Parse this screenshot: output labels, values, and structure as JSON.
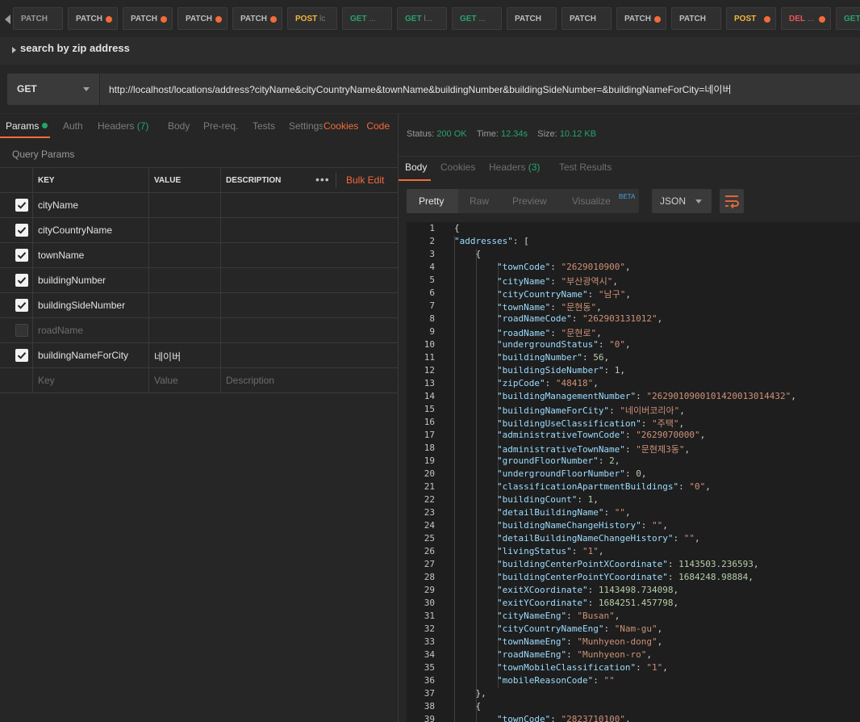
{
  "tabs": [
    {
      "method": "PATCH",
      "color": "#9a9a9a",
      "dirty": false
    },
    {
      "method": "PATCH",
      "color": "#bdbdbd",
      "dirty": true
    },
    {
      "method": "PATCH",
      "color": "#bdbdbd",
      "dirty": true
    },
    {
      "method": "PATCH",
      "color": "#bdbdbd",
      "dirty": true
    },
    {
      "method": "PATCH",
      "color": "#bdbdbd",
      "dirty": true
    },
    {
      "method": "POST",
      "color": "#f5b73b",
      "dirty": false,
      "suffix": " lc"
    },
    {
      "method": "GET",
      "color": "#25a46b",
      "dirty": false,
      "suffix": " ..."
    },
    {
      "method": "GET",
      "color": "#25a46b",
      "dirty": false,
      "suffix": " l..."
    },
    {
      "method": "GET",
      "color": "#25a46b",
      "dirty": false,
      "suffix": " ..."
    },
    {
      "method": "PATCH",
      "color": "#bdbdbd",
      "dirty": false
    },
    {
      "method": "PATCH",
      "color": "#bdbdbd",
      "dirty": false
    },
    {
      "method": "PATCH",
      "color": "#bdbdbd",
      "dirty": true
    },
    {
      "method": "PATCH",
      "color": "#bdbdbd",
      "dirty": false
    },
    {
      "method": "POST",
      "color": "#f5b73b",
      "dirty": true
    },
    {
      "method": "DEL",
      "color": "#e8555a",
      "dirty": true,
      "suffix": " ..."
    },
    {
      "method": "GET",
      "color": "#25a46b",
      "dirty": false
    }
  ],
  "request": {
    "title": "search by zip address",
    "method": "GET",
    "url": "http://localhost/locations/address?cityName&cityCountryName&townName&buildingNumber&buildingSideNumber=&buildingNameForCity=네이버"
  },
  "req_tabs": {
    "params": "Params",
    "auth": "Auth",
    "headers": "Headers",
    "headers_count": "(7)",
    "body": "Body",
    "prereq": "Pre-req.",
    "tests": "Tests",
    "settings": "Settings",
    "cookies": "Cookies",
    "code": "Code"
  },
  "query_params_label": "Query Params",
  "param_headers": {
    "key": "KEY",
    "value": "VALUE",
    "description": "DESCRIPTION",
    "more": "•••",
    "bulk_edit": "Bulk Edit"
  },
  "params": [
    {
      "key": "cityName",
      "value": "",
      "checked": true
    },
    {
      "key": "cityCountryName",
      "value": "",
      "checked": true
    },
    {
      "key": "townName",
      "value": "",
      "checked": true
    },
    {
      "key": "buildingNumber",
      "value": "",
      "checked": true
    },
    {
      "key": "buildingSideNumber",
      "value": "",
      "checked": true
    },
    {
      "key": "roadName",
      "value": "",
      "checked": false
    },
    {
      "key": "buildingNameForCity",
      "value": "네이버",
      "checked": true
    }
  ],
  "param_placeholders": {
    "key": "Key",
    "value": "Value",
    "description": "Description"
  },
  "response": {
    "status_label": "Status:",
    "status": "200 OK",
    "time_label": "Time:",
    "time": "12.34s",
    "size_label": "Size:",
    "size": "10.12 KB",
    "tabs": {
      "body": "Body",
      "cookies": "Cookies",
      "headers": "Headers",
      "headers_count": "(3)",
      "tests": "Test Results"
    },
    "view": {
      "pretty": "Pretty",
      "raw": "Raw",
      "preview": "Preview",
      "visualize": "Visualize",
      "beta": "BETA",
      "format": "JSON"
    }
  },
  "code_lines": [
    "{",
    "    \"addresses\": [",
    "        {",
    "            \"townCode\": \"2629010900\",",
    "            \"cityName\": \"부산광역시\",",
    "            \"cityCountryName\": \"남구\",",
    "            \"townName\": \"문현동\",",
    "            \"roadNameCode\": \"262903131012\",",
    "            \"roadName\": \"문현로\",",
    "            \"undergroundStatus\": \"0\",",
    "            \"buildingNumber\": 56,",
    "            \"buildingSideNumber\": 1,",
    "            \"zipCode\": \"48418\",",
    "            \"buildingManagementNumber\": \"2629010900101420013014432\",",
    "            \"buildingNameForCity\": \"네이버코리아\",",
    "            \"buildingUseClassification\": \"주택\",",
    "            \"administrativeTownCode\": \"2629070000\",",
    "            \"administrativeTownName\": \"문현제3동\",",
    "            \"groundFloorNumber\": 2,",
    "            \"undergroundFloorNumber\": 0,",
    "            \"classificationApartmentBuildings\": \"0\",",
    "            \"buildingCount\": 1,",
    "            \"detailBuildingName\": \"\",",
    "            \"buildingNameChangeHistory\": \"\",",
    "            \"detailBuildingNameChangeHistory\": \"\",",
    "            \"livingStatus\": \"1\",",
    "            \"buildingCenterPointXCoordinate\": 1143503.236593,",
    "            \"buildingCenterPointYCoordinate\": 1684248.98884,",
    "            \"exitXCoordinate\": 1143498.734098,",
    "            \"exitYCoordinate\": 1684251.457798,",
    "            \"cityNameEng\": \"Busan\",",
    "            \"cityCountryNameEng\": \"Nam-gu\",",
    "            \"townNameEng\": \"Munhyeon-dong\",",
    "            \"roadNameEng\": \"Munhyeon-ro\",",
    "            \"townMobileClassification\": \"1\",",
    "            \"mobileReasonCode\": \"\"",
    "        },",
    "        {",
    "            \"townCode\": \"2823710100\","
  ],
  "colors": {
    "accent": "#f26b3a",
    "success": "#25a46b",
    "post": "#f5b73b",
    "delete": "#e8555a",
    "json_key": "#9cdcfe",
    "json_string": "#ce9178",
    "json_number": "#b5cea8"
  }
}
